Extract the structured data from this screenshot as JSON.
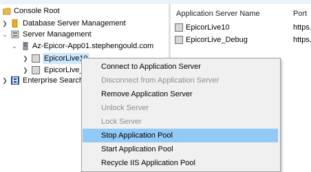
{
  "tree": {
    "items": [
      {
        "label": "Console Root",
        "icon": "folder-icon"
      },
      {
        "label": "Database Server Management",
        "icon": "database-icon"
      },
      {
        "label": "Server Management",
        "icon": "server-management-icon"
      },
      {
        "label": "Az-Epicor-App01.stephengould.com",
        "icon": "server-icon"
      },
      {
        "label": "EpicorLive10",
        "icon": "app-server-icon"
      },
      {
        "label": "EpicorLive_",
        "icon": "app-server-icon"
      },
      {
        "label": "Enterprise Search M",
        "icon": "enterprise-search-icon"
      }
    ]
  },
  "list": {
    "columns": [
      "Application Server Name",
      "Port"
    ],
    "rows": [
      {
        "name": "EpicorLive10",
        "port": "https."
      },
      {
        "name": "EpicorLive_Debug",
        "port": "https."
      }
    ]
  },
  "context_menu": {
    "items": [
      {
        "label": "Connect to Application Server",
        "enabled": true
      },
      {
        "label": "Disconnect from Application Server",
        "enabled": false
      },
      {
        "label": "Remove Application Server",
        "enabled": true
      },
      {
        "label": "Unlock Server",
        "enabled": false
      },
      {
        "label": "Lock Server",
        "enabled": false
      },
      {
        "label": "Stop Application Pool",
        "enabled": true,
        "highlighted": true
      },
      {
        "label": "Start Application Pool",
        "enabled": true
      },
      {
        "label": "Recycle IIS Application Pool",
        "enabled": true
      }
    ]
  },
  "colors": {
    "selection": "#cce8ff",
    "menu_highlight": "#91c9f7",
    "enterprise_icon": "#1c4d8f"
  }
}
